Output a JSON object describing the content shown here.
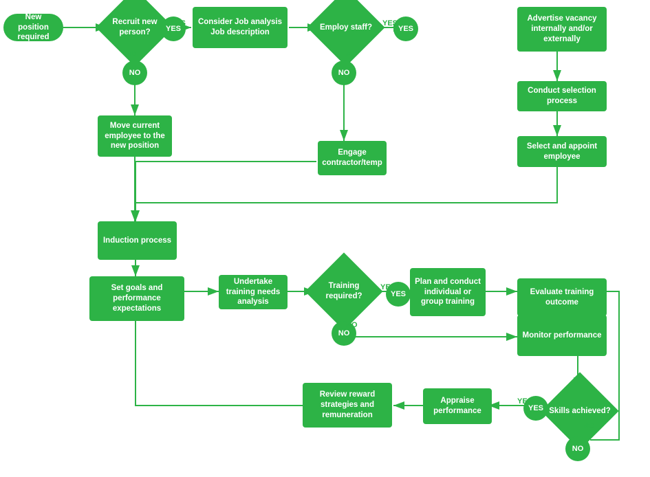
{
  "nodes": {
    "new_position": {
      "label": "New position required"
    },
    "recruit_new": {
      "label": "Recruit new person?"
    },
    "consider_job": {
      "label": "Consider Job analysis Job description"
    },
    "employ_staff": {
      "label": "Employ staff?"
    },
    "advertise": {
      "label": "Advertise vacancy internally and/or externally"
    },
    "conduct_selection": {
      "label": "Conduct selection process"
    },
    "select_appoint": {
      "label": "Select and appoint employee"
    },
    "engage_contractor": {
      "label": "Engage contractor/temp"
    },
    "move_employee": {
      "label": "Move current employee to the new position"
    },
    "induction": {
      "label": "Induction process"
    },
    "set_goals": {
      "label": "Set goals and performance expectations"
    },
    "training_needs": {
      "label": "Undertake training needs analysis"
    },
    "training_required": {
      "label": "Training required?"
    },
    "plan_conduct": {
      "label": "Plan and conduct individual or group training"
    },
    "evaluate_training": {
      "label": "Evaluate training outcome"
    },
    "monitor_performance": {
      "label": "Monitor performance"
    },
    "skills_achieved": {
      "label": "Skills achieved?"
    },
    "appraise": {
      "label": "Appraise performance"
    },
    "review_reward": {
      "label": "Review reward strategies and remuneration"
    }
  },
  "labels": {
    "yes": "YES",
    "no": "NO"
  },
  "colors": {
    "green": "#2db346",
    "white": "#ffffff"
  }
}
